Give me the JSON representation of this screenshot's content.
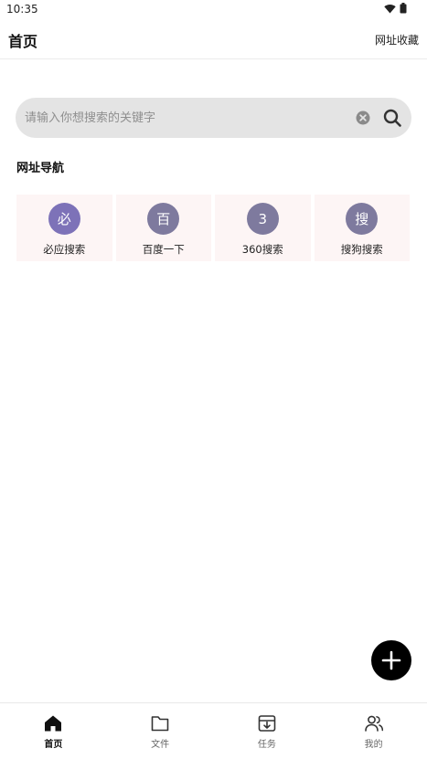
{
  "status_bar": {
    "time": "10:35"
  },
  "header": {
    "title": "首页",
    "bookmarks_label": "网址收藏"
  },
  "search": {
    "placeholder": "请输入你想搜索的关键字",
    "value": ""
  },
  "section": {
    "title": "网址导航"
  },
  "nav_sites": [
    {
      "badge": "必",
      "label": "必应搜索",
      "color": "#7d72b8"
    },
    {
      "badge": "百",
      "label": "百度一下",
      "color": "#7e7a9e"
    },
    {
      "badge": "3",
      "label": "360搜索",
      "color": "#7e7a9e"
    },
    {
      "badge": "搜",
      "label": "搜狗搜索",
      "color": "#7e7a9e"
    }
  ],
  "bottom_nav": [
    {
      "label": "首页",
      "icon": "home-icon",
      "active": true
    },
    {
      "label": "文件",
      "icon": "folder-icon",
      "active": false
    },
    {
      "label": "任务",
      "icon": "download-box-icon",
      "active": false
    },
    {
      "label": "我的",
      "icon": "users-icon",
      "active": false
    }
  ],
  "colors": {
    "search_bg": "#e4e4e4",
    "card_bg": "#fdf5f5",
    "fab_bg": "#000000"
  }
}
